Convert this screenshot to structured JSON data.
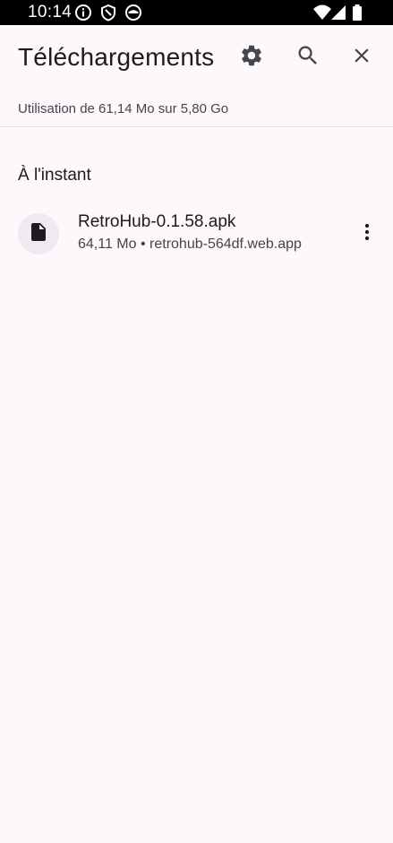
{
  "status_bar": {
    "time": "10:14",
    "icons": [
      "info-icon",
      "shield-icon",
      "face-icon",
      "wifi-icon",
      "signal-icon",
      "battery-icon"
    ]
  },
  "app_bar": {
    "title": "Téléchargements",
    "actions": [
      "settings-icon",
      "search-icon",
      "close-icon"
    ]
  },
  "storage": {
    "text": "Utilisation de 61,14 Mo sur 5,80 Go"
  },
  "sections": [
    {
      "header": "À l'instant",
      "items": [
        {
          "name": "RetroHub-0.1.58.apk",
          "meta": "64,11 Mo • retrohub-564df.web.app",
          "icon": "file-icon"
        }
      ]
    }
  ],
  "colors": {
    "background": "#fcf8fb",
    "text_primary": "#1d1b1e",
    "text_secondary": "#45454a",
    "icon_bg": "#eeeaef",
    "icon": "#47464b"
  }
}
